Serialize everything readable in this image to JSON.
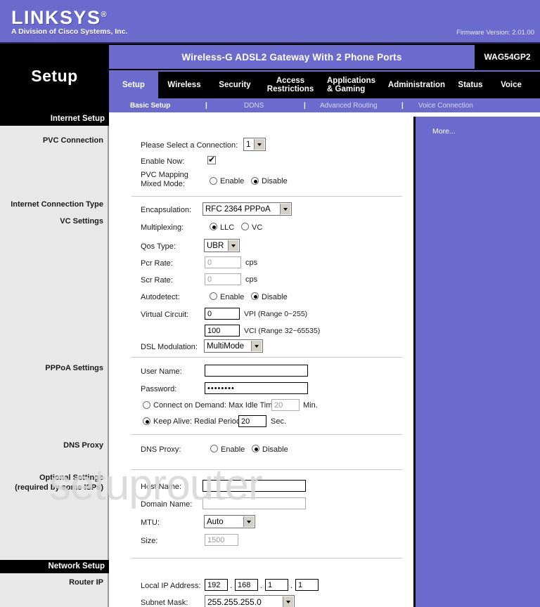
{
  "header": {
    "brand": "LINKSYS",
    "brand_reg": "®",
    "brand_sub": "A Division of Cisco Systems, Inc.",
    "firmware": "Firmware Version: 2.01.00",
    "model_name": "Wireless-G ADSL2 Gateway With 2 Phone Ports",
    "model_number": "WAG54GP2",
    "page_title": "Setup",
    "brand_color": "#6b6bce"
  },
  "tabs": [
    {
      "label": "Setup",
      "active": true
    },
    {
      "label": "Wireless",
      "active": false
    },
    {
      "label": "Security",
      "active": false
    },
    {
      "label": "Access\nRestrictions",
      "active": false
    },
    {
      "label": "Applications\n& Gaming",
      "active": false
    },
    {
      "label": "Administration",
      "active": false
    },
    {
      "label": "Status",
      "active": false
    },
    {
      "label": "Voice",
      "active": false
    }
  ],
  "subnav": [
    {
      "label": "Basic Setup",
      "active": true
    },
    {
      "label": "DDNS",
      "active": false
    },
    {
      "label": "Advanced Routing",
      "active": false
    },
    {
      "label": "Voice Connection",
      "active": false
    }
  ],
  "subnav_separator": "|",
  "sidebar": {
    "sections": [
      {
        "label": "Internet Setup",
        "type": "header"
      },
      {
        "label": "PVC Connection",
        "type": "item"
      },
      {
        "label": "Internet Connection Type",
        "type": "item"
      },
      {
        "label": "VC Settings",
        "type": "item"
      },
      {
        "label": "PPPoA Settings",
        "type": "item"
      },
      {
        "label": "DNS Proxy",
        "type": "item"
      },
      {
        "label": "Optional Settings",
        "type": "item"
      },
      {
        "label": "(required by some ISPs)",
        "type": "item"
      },
      {
        "label": "Network Setup",
        "type": "header"
      },
      {
        "label": "Router IP",
        "type": "item"
      }
    ]
  },
  "help": {
    "more_link": "More..."
  },
  "watermark": "setuprouter",
  "form": {
    "select_connection": {
      "label": "Please Select a Connection:",
      "value": "1"
    },
    "enable_now": {
      "label": "Enable Now:",
      "checked": true
    },
    "pvc_mapping": {
      "label_line1": "PVC Mapping",
      "label_line2": "Mixed Mode:",
      "enable_label": "Enable",
      "disable_label": "Disable",
      "selected": "Disable"
    },
    "encapsulation": {
      "label": "Encapsulation:",
      "value": "RFC 2364 PPPoA"
    },
    "multiplexing": {
      "label": "Multiplexing:",
      "llc_label": "LLC",
      "vc_label": "VC",
      "selected": "LLC"
    },
    "qos_type": {
      "label": "Qos Type:",
      "value": "UBR"
    },
    "pcr_rate": {
      "label": "Pcr Rate:",
      "value": "0",
      "unit": "cps"
    },
    "scr_rate": {
      "label": "Scr Rate:",
      "value": "0",
      "unit": "cps"
    },
    "autodetect": {
      "label": "Autodetect:",
      "enable_label": "Enable",
      "disable_label": "Disable",
      "selected": "Disable"
    },
    "virtual_circuit": {
      "label": "Virtual Circuit:",
      "vpi_value": "0",
      "vpi_hint": "VPI (Range 0~255)",
      "vci_value": "100",
      "vci_hint": "VCI (Range 32~65535)"
    },
    "dsl_modulation": {
      "label": "DSL Modulation:",
      "value": "MultiMode"
    },
    "user_name": {
      "label": "User Name:",
      "value": ""
    },
    "password": {
      "label": "Password:",
      "value": "••••••••"
    },
    "connect_on_demand": {
      "label": "Connect on Demand: Max Idle Time",
      "value": "20",
      "unit": "Min.",
      "selected": false
    },
    "keep_alive": {
      "label": "Keep Alive: Redial Period",
      "value": "20",
      "unit": "Sec.",
      "selected": true
    },
    "dns_proxy": {
      "label": "DNS Proxy:",
      "enable_label": "Enable",
      "disable_label": "Disable",
      "selected": "Disable"
    },
    "host_name": {
      "label": "Host Name:",
      "value": ""
    },
    "domain_name": {
      "label": "Domain Name:",
      "value": ""
    },
    "mtu": {
      "label": "MTU:",
      "value": "Auto"
    },
    "size": {
      "label": "Size:",
      "value": "1500"
    },
    "local_ip": {
      "label": "Local IP Address:",
      "octets": [
        "192",
        "168",
        "1",
        "1"
      ],
      "separator": "."
    },
    "subnet_mask": {
      "label": "Subnet Mask:",
      "value": "255.255.255.0"
    }
  }
}
